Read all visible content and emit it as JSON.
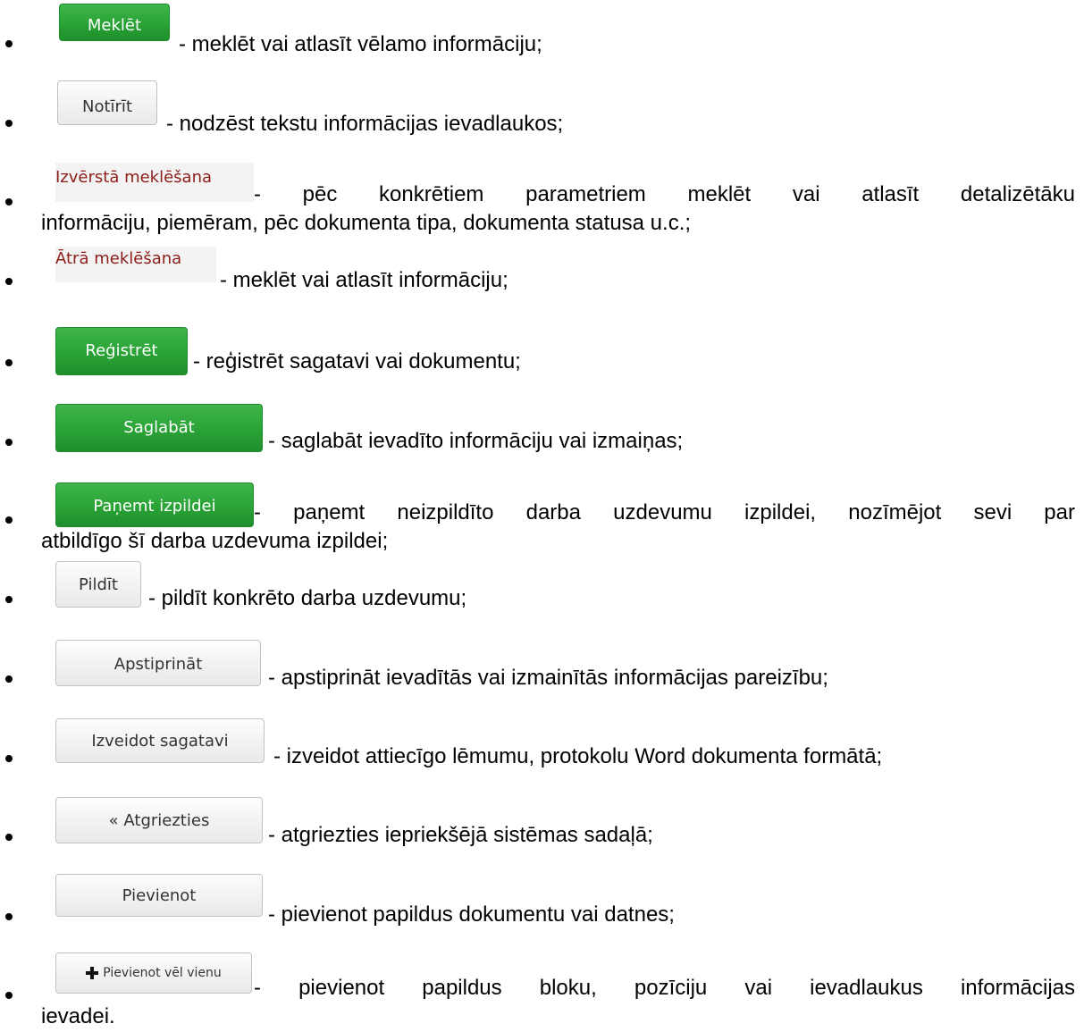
{
  "items": [
    {
      "label": "Meklēt",
      "description": "- meklēt vai atlasīt vēlamo informāciju;"
    },
    {
      "label": "Notīrīt",
      "description": "- nodzēst tekstu informācijas ievadlaukos;"
    },
    {
      "label": "Izvērstā meklēšana",
      "description_line1": "- pēc konkrētiem parametriem meklēt vai atlasīt detalizētāku",
      "description_line2": "informāciju, piemēram, pēc dokumenta tipa, dokumenta statusa u.c.;"
    },
    {
      "label": "Ātrā meklēšana",
      "description": "- meklēt vai atlasīt informāciju;"
    },
    {
      "label": "Reģistrēt",
      "description": "- reģistrēt sagatavi vai dokumentu;"
    },
    {
      "label": "Saglabāt",
      "description": "- saglabāt ievadīto informāciju vai izmaiņas;"
    },
    {
      "label": "Paņemt izpildei",
      "description_line1": "- paņemt neizpildīto darba uzdevumu izpildei, nozīmējot sevi par",
      "description_line2": "atbildīgo šī darba uzdevuma izpildei;"
    },
    {
      "label": "Pildīt",
      "description": "- pildīt konkrēto darba uzdevumu;"
    },
    {
      "label": "Apstiprināt",
      "description": "- apstiprināt ievadītās vai izmainītās informācijas pareizību;"
    },
    {
      "label": "Izveidot sagatavi",
      "description": "- izveidot attiecīgo lēmumu, protokolu Word dokumenta formātā;"
    },
    {
      "label": "« Atgriezties",
      "description": "- atgriezties iepriekšējā sistēmas sadaļā;"
    },
    {
      "label": "Pievienot",
      "description": "- pievienot papildus dokumentu vai datnes;"
    },
    {
      "label": "Pievienot vēl vienu",
      "icon": "plus-icon",
      "description_line1": "- pievienot papildus bloku, pozīciju vai ievadlaukus informācijas",
      "description_line2": "ievadei."
    }
  ],
  "colors": {
    "green_button": "#2aa236",
    "gray_button": "#eeeeee",
    "link_text": "#8c1d18",
    "link_background": "#f3f3f3"
  }
}
